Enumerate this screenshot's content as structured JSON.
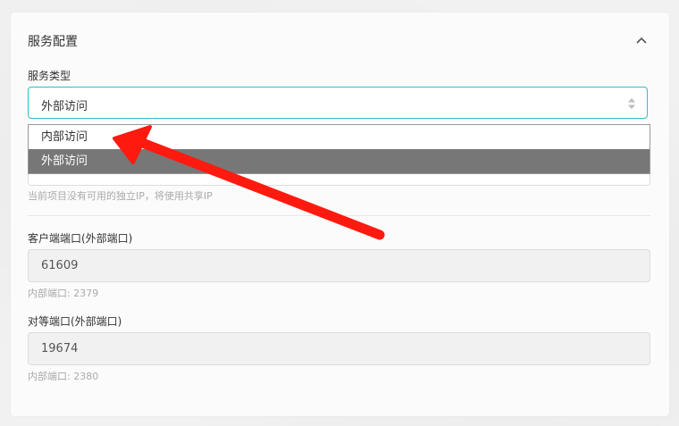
{
  "section": {
    "title": "服务配置",
    "collapse_icon": "chevron-up-icon"
  },
  "service_type": {
    "label": "服务类型",
    "selected_value": "外部访问",
    "options": [
      "内部访问",
      "外部访问"
    ],
    "highlighted_option": "外部访问",
    "help_text": "当前项目没有可用的独立IP，将使用共享IP"
  },
  "client_port": {
    "label": "客户端端口(外部端口)",
    "value": "61609",
    "help_text": "内部端口: 2379"
  },
  "peer_port": {
    "label": "对等端口(外部端口)",
    "value": "19674",
    "help_text": "内部端口: 2380"
  },
  "colors": {
    "accent": "#2cc0c5",
    "selected_option_bg": "#777777",
    "annotation_arrow": "#ff1a10"
  }
}
